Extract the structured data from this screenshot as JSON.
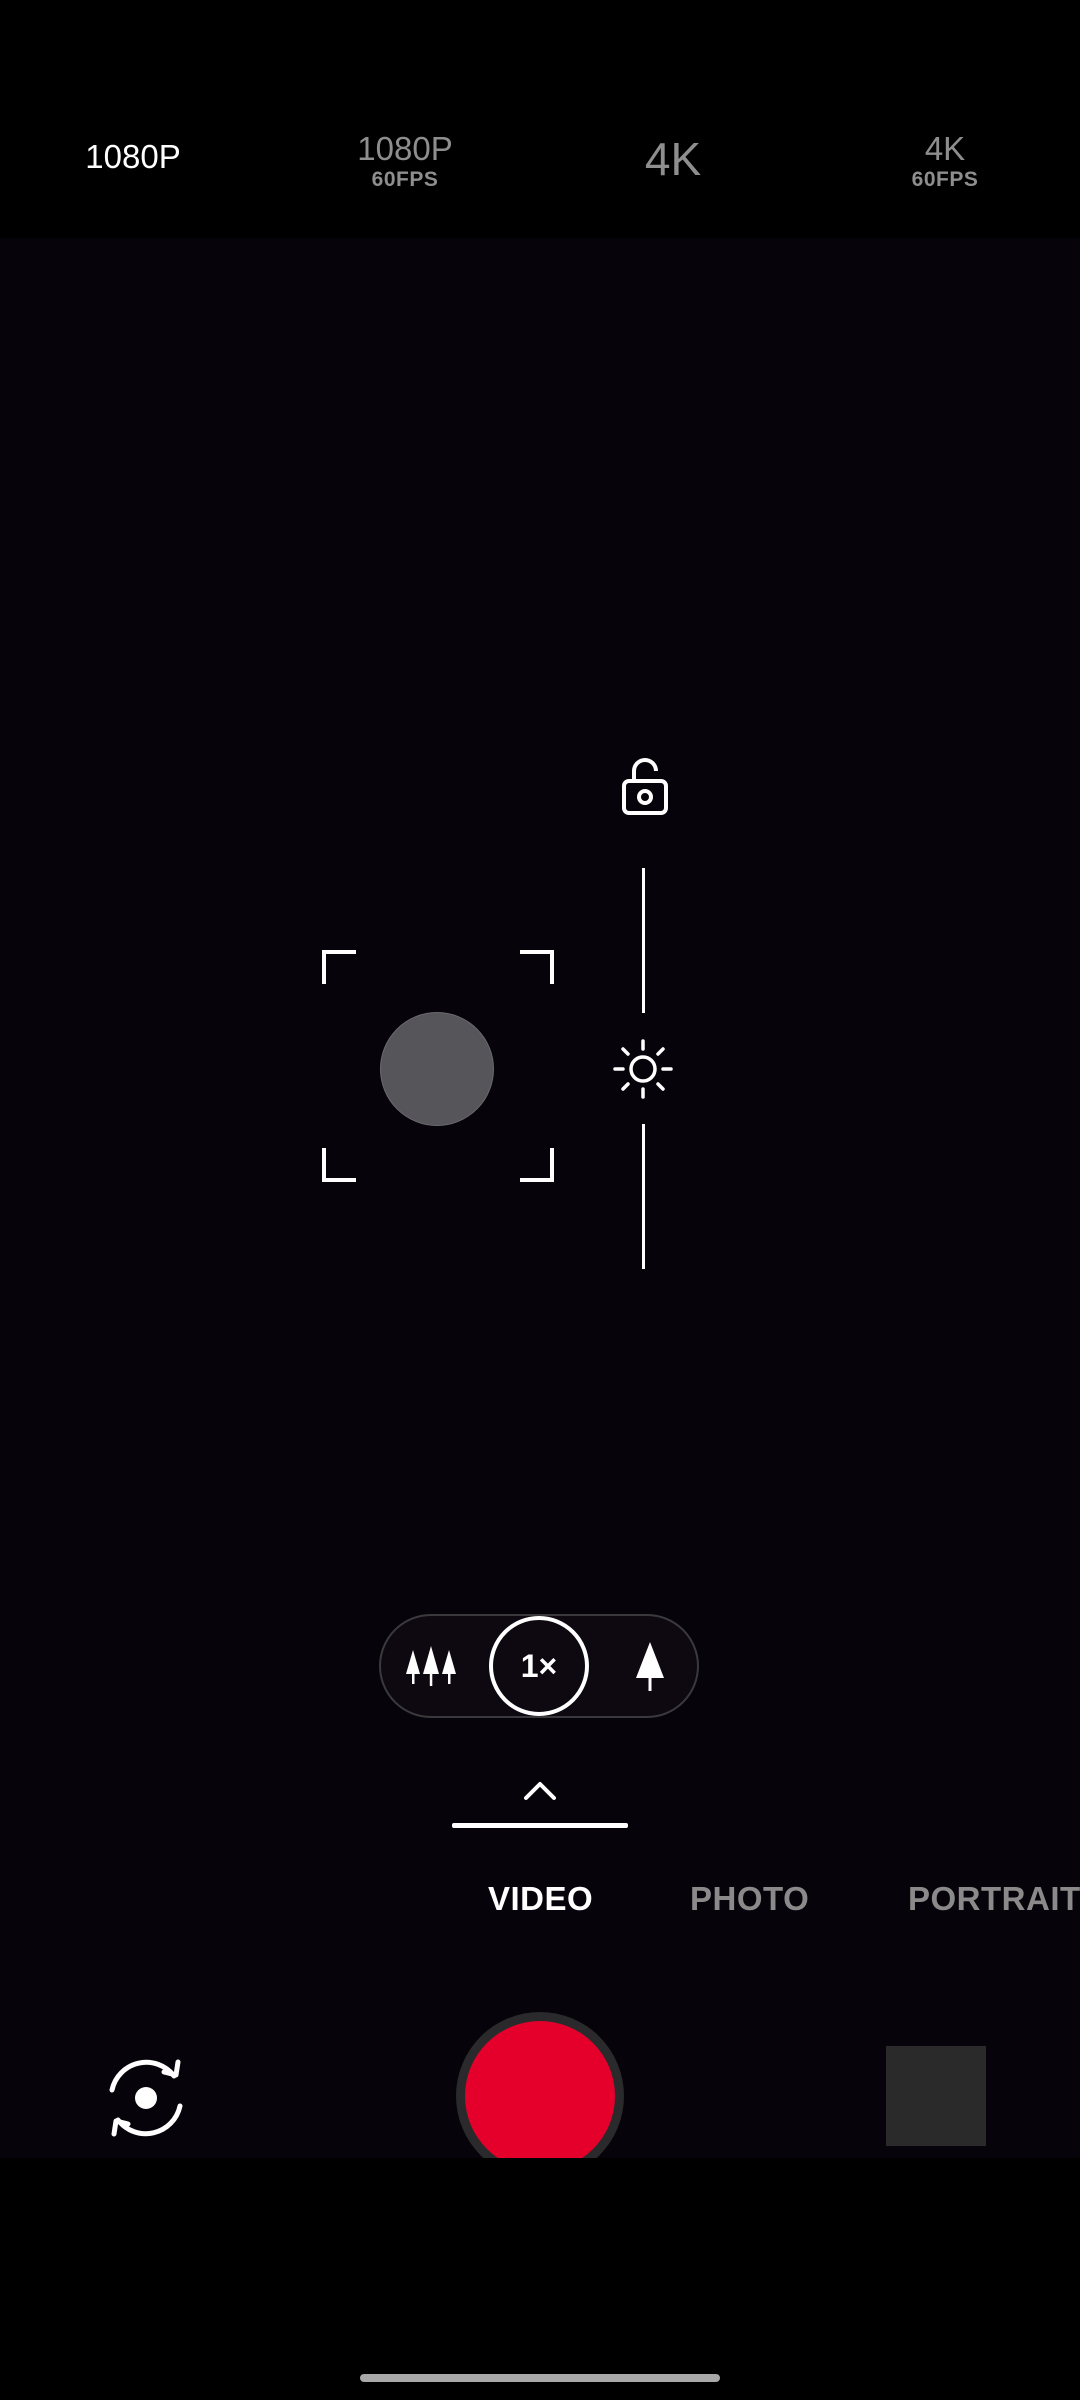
{
  "top_bar": {
    "options": [
      {
        "main": "1080P",
        "sub": "",
        "selected": true
      },
      {
        "main": "1080P",
        "sub": "60FPS",
        "selected": false
      },
      {
        "main": "4K",
        "sub": "",
        "selected": false
      },
      {
        "main": "4K",
        "sub": "60FPS",
        "selected": false
      }
    ]
  },
  "zoom": {
    "current": "1×",
    "wide_icon": "trees-wide-icon",
    "tele_icon": "tree-tele-icon"
  },
  "modes": {
    "items": [
      "VIDEO",
      "PHOTO",
      "PORTRAIT"
    ],
    "selected": "VIDEO"
  },
  "colors": {
    "shutter": "#e5002b",
    "active_text": "#ffffff",
    "inactive_text": "#8a8a8a",
    "viewfinder": "#07030a"
  },
  "icons": {
    "exposure_lock": "unlock-icon",
    "exposure": "sun-icon",
    "flip_camera": "flip-camera-icon",
    "mode_expand": "chevron-up-icon"
  }
}
